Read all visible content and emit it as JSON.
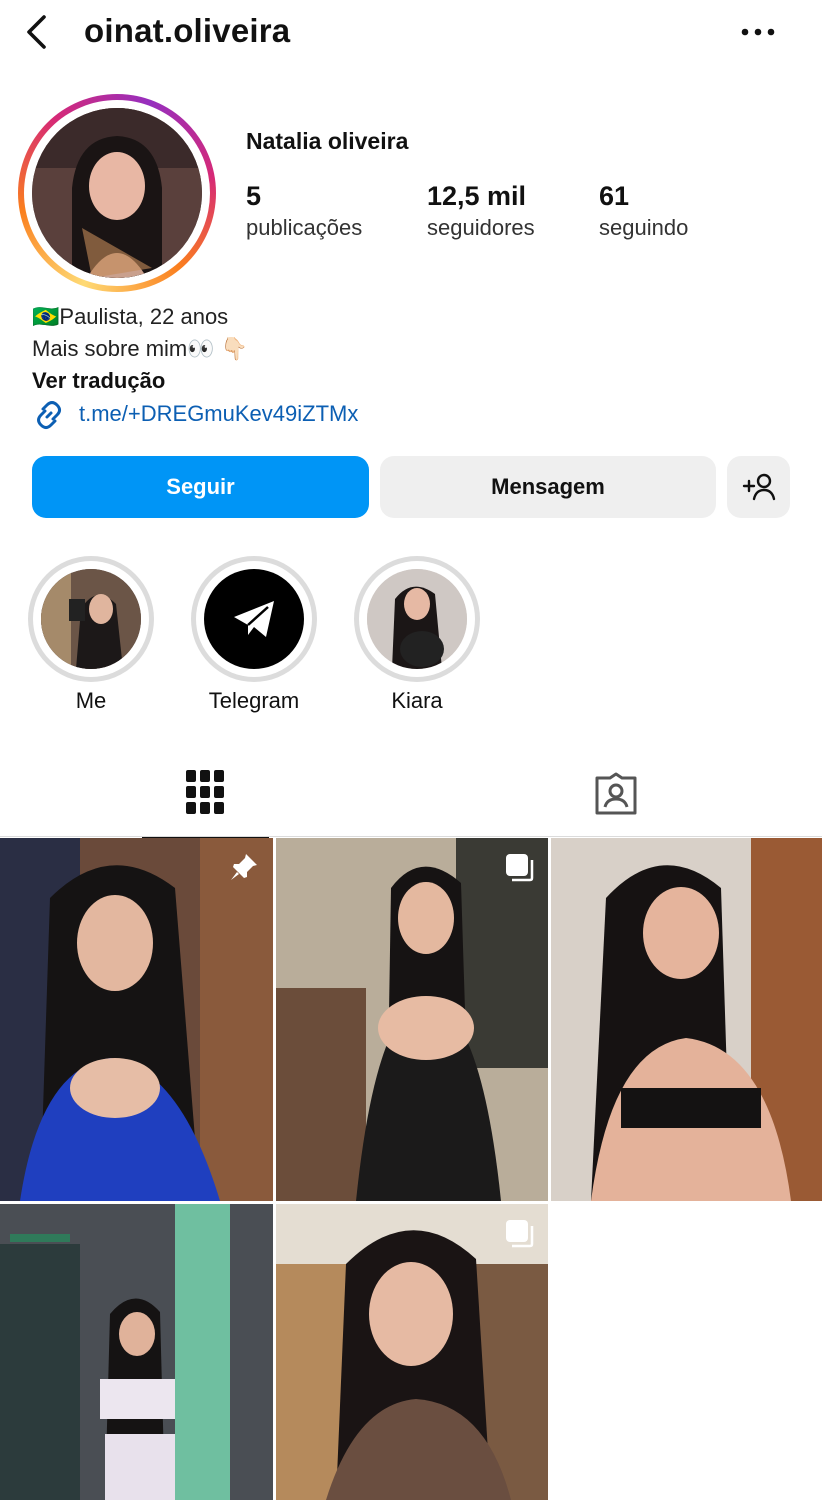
{
  "header": {
    "username": "oinat.oliveira"
  },
  "profile": {
    "display_name": "Natalia oliveira",
    "stats": [
      {
        "value": "5",
        "label": "publicações"
      },
      {
        "value": "12,5 mil",
        "label": "seguidores"
      },
      {
        "value": "61",
        "label": "seguindo"
      }
    ],
    "bio_lines": [
      "🇧🇷Paulista, 22 anos",
      "Mais sobre mim👀 👇🏻"
    ],
    "translate_label": "Ver tradução",
    "link": "t.me/+DREGmuKev49iZTMx"
  },
  "actions": {
    "follow_label": "Seguir",
    "message_label": "Mensagem"
  },
  "highlights": [
    {
      "label": "Me"
    },
    {
      "label": "Telegram"
    },
    {
      "label": "Kiara"
    }
  ],
  "tabs": [
    "posts-grid",
    "tagged"
  ],
  "posts": [
    {
      "badge": "pin-icon"
    },
    {
      "badge": "carousel-icon"
    },
    {
      "badge": ""
    },
    {
      "badge": ""
    },
    {
      "badge": "carousel-icon"
    }
  ],
  "colors": {
    "follow": "#0095f6",
    "link": "#0c5fb3",
    "button_gray": "#efefef"
  }
}
